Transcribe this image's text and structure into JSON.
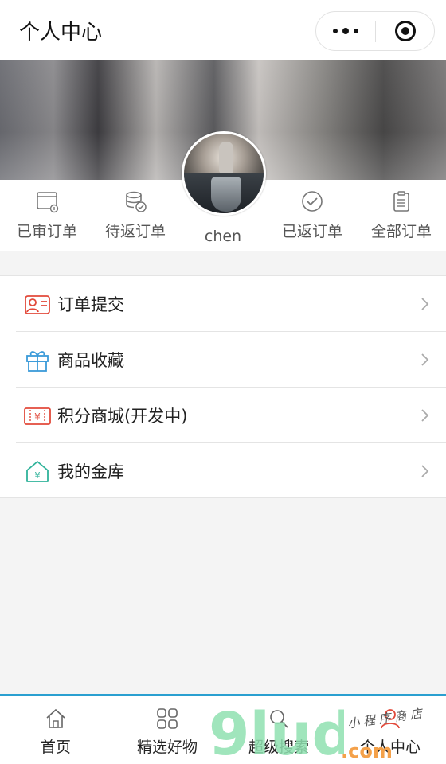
{
  "navbar": {
    "title": "个人中心"
  },
  "orders": {
    "items": [
      {
        "label": "已审订单",
        "icon": "window-info-icon"
      },
      {
        "label": "待返订单",
        "icon": "coins-check-icon"
      },
      {
        "label": "已返订单",
        "icon": "check-circle-icon"
      },
      {
        "label": "全部订单",
        "icon": "clipboard-icon"
      }
    ]
  },
  "profile": {
    "username": "chen"
  },
  "menu": {
    "items": [
      {
        "label": "订单提交",
        "icon": "user-card-icon",
        "color": "#e24a3b"
      },
      {
        "label": "商品收藏",
        "icon": "gift-icon",
        "color": "#3a9ad9"
      },
      {
        "label": "积分商城(开发中)",
        "icon": "ticket-yen-icon",
        "color": "#e24a3b"
      },
      {
        "label": "我的金库",
        "icon": "house-yen-icon",
        "color": "#2fb39a"
      }
    ]
  },
  "tabbar": {
    "items": [
      {
        "label": "首页",
        "icon": "home-icon"
      },
      {
        "label": "精选好物",
        "icon": "grid-icon"
      },
      {
        "label": "超级搜索",
        "icon": "search-icon"
      },
      {
        "label": "个人中心",
        "icon": "user-icon",
        "active": true
      }
    ],
    "accent": "#2a9fd0",
    "active_color": "#e24a3b"
  },
  "watermark": {
    "text": "9lud",
    "domain": ".com",
    "script": "小 程 序 商 店"
  }
}
